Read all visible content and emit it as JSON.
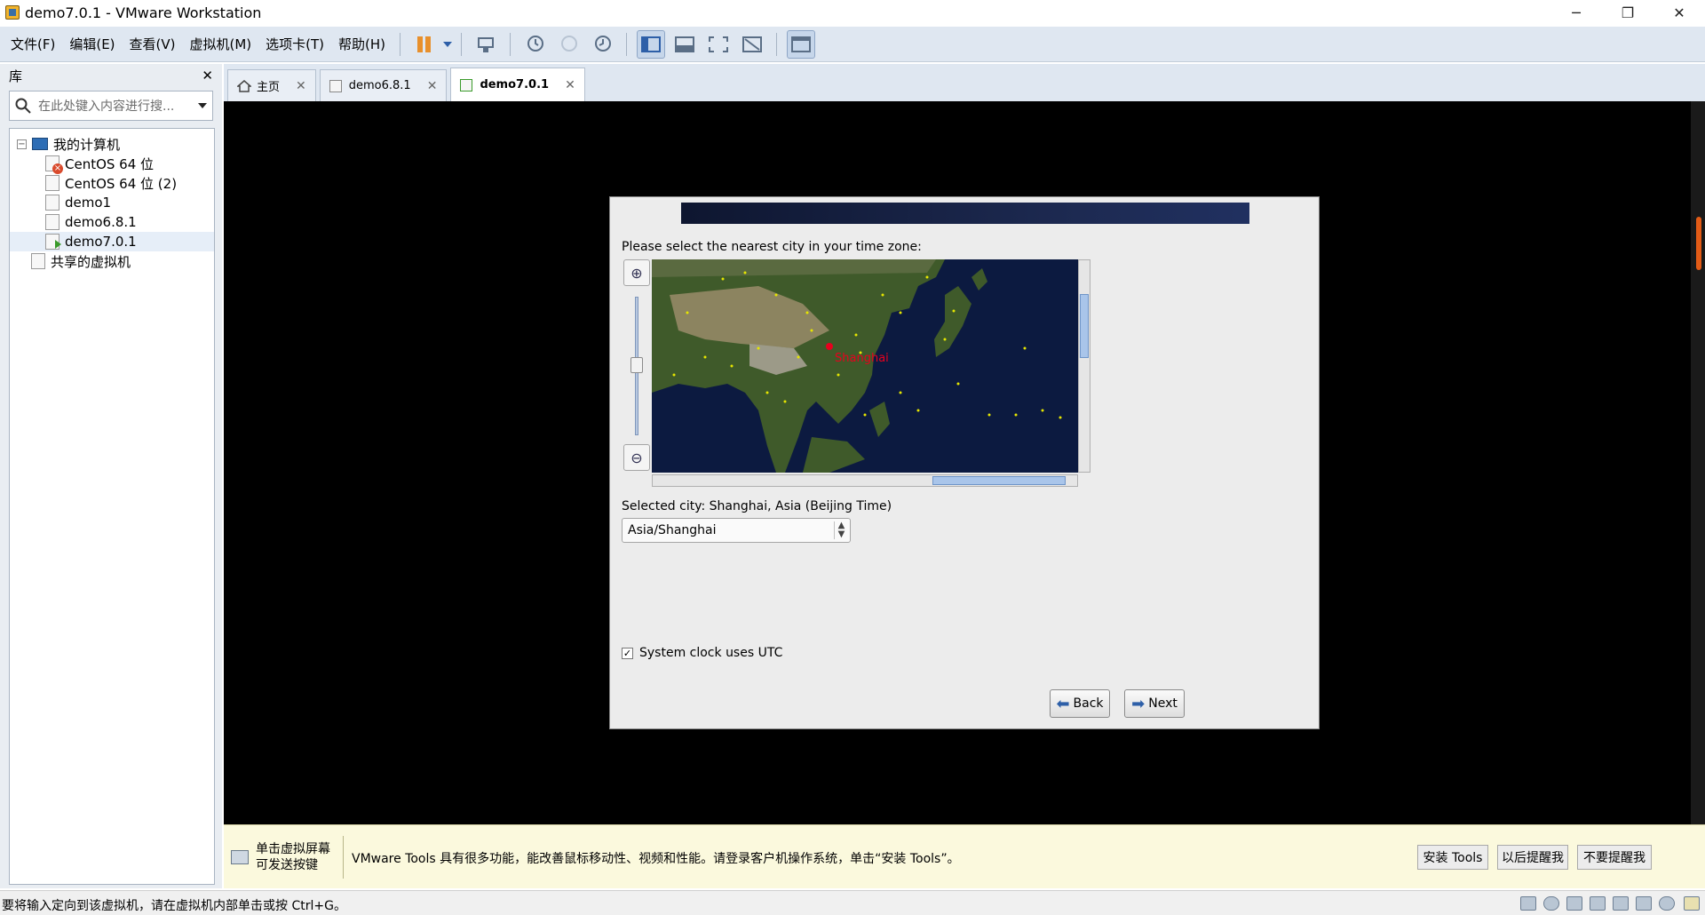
{
  "window": {
    "title": "demo7.0.1 - VMware Workstation",
    "controls": {
      "minimize": "─",
      "restore": "❐",
      "close": "✕"
    }
  },
  "menu": {
    "items": [
      "文件(F)",
      "编辑(E)",
      "查看(V)",
      "虚拟机(M)",
      "选项卡(T)",
      "帮助(H)"
    ]
  },
  "library": {
    "title": "库",
    "close": "✕",
    "search_placeholder": "在此处键入内容进行搜...",
    "tree": {
      "root": "我的计算机",
      "vms": [
        "CentOS 64 位",
        "CentOS 64 位 (2)",
        "demo1",
        "demo6.8.1",
        "demo7.0.1"
      ],
      "shared": "共享的虚拟机"
    }
  },
  "tabs": [
    {
      "label": "主页"
    },
    {
      "label": "demo6.8.1"
    },
    {
      "label": "demo7.0.1"
    }
  ],
  "tab_close": "✕",
  "installer": {
    "prompt": "Please select the nearest city in your time zone:",
    "city_on_map": "Shanghai",
    "selected_city": "Selected city: Shanghai, Asia (Beijing Time)",
    "timezone_value": "Asia/Shanghai",
    "utc_label": "System clock uses UTC",
    "utc_checked": true,
    "back_label": "Back",
    "next_label": "Next"
  },
  "tools_bar": {
    "hint": "单击虚拟屏幕\n可发送按键",
    "hint_line1": "单击虚拟屏幕",
    "hint_line2": "可发送按键",
    "message": "VMware Tools 具有很多功能，能改善鼠标移动性、视频和性能。请登录客户机操作系统，单击“安装 Tools”。",
    "install_label": "安装 Tools",
    "later_label": "以后提醒我",
    "never_label": "不要提醒我"
  },
  "status": {
    "text": "要将输入定向到该虚拟机，请在虚拟机内部单击或按 Ctrl+G。"
  },
  "colors": {
    "accent": "#2d5fa8",
    "vm_background": "#000000",
    "notification": "#fbf9dd"
  }
}
